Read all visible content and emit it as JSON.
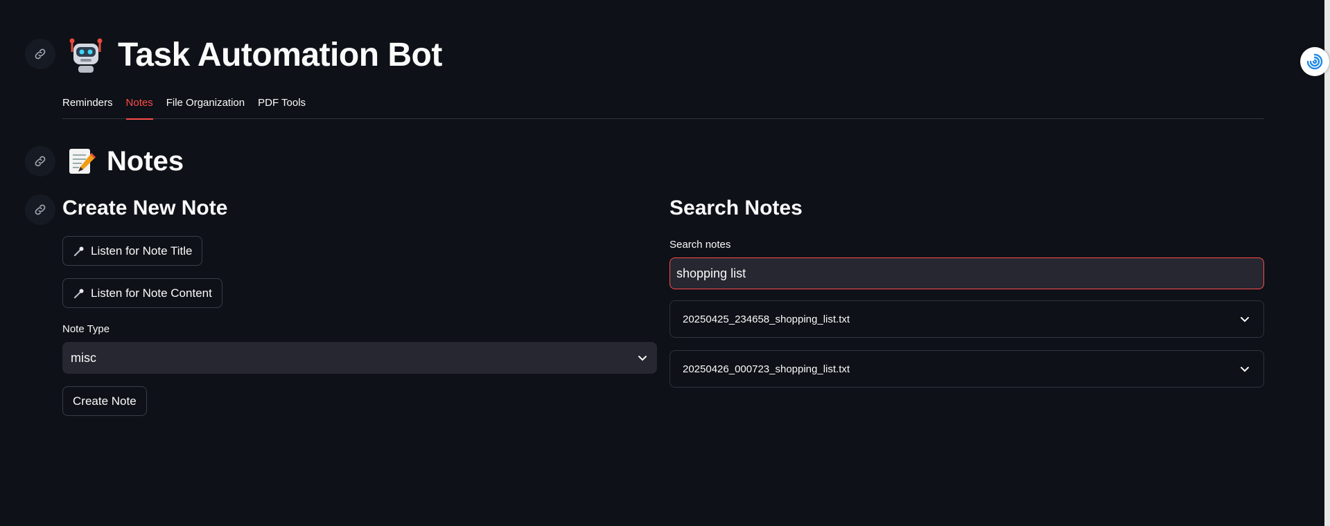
{
  "app": {
    "title": "Task Automation Bot"
  },
  "tabs": [
    {
      "label": "Reminders",
      "active": false
    },
    {
      "label": "Notes",
      "active": true
    },
    {
      "label": "File Organization",
      "active": false
    },
    {
      "label": "PDF Tools",
      "active": false
    }
  ],
  "section": {
    "title": "Notes"
  },
  "create": {
    "title": "Create New Note",
    "listen_title_label": "Listen for Note Title",
    "listen_content_label": "Listen for Note Content",
    "note_type_label": "Note Type",
    "note_type_value": "misc",
    "create_button_label": "Create Note"
  },
  "search": {
    "title": "Search Notes",
    "input_label": "Search notes",
    "input_value": "shopping list",
    "results": [
      {
        "label": "20250425_234658_shopping_list.txt"
      },
      {
        "label": "20250426_000723_shopping_list.txt"
      }
    ]
  },
  "colors": {
    "background": "#0e1117",
    "accent": "#ff4b4b",
    "input_bg": "#262730",
    "border": "#31333f"
  },
  "icons": {
    "anchor": "link-icon",
    "app": "robot-icon",
    "section": "memo-icon",
    "mic": "microphone-icon",
    "expand": "chevron-down-icon",
    "extension": "swirl-icon"
  }
}
